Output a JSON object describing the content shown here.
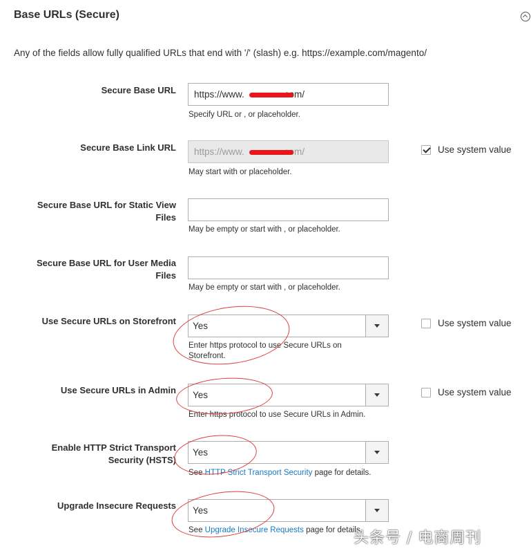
{
  "section": {
    "title": "Base URLs (Secure)",
    "intro": "Any of the fields allow fully qualified URLs that end with '/' (slash) e.g. https://example.com/magento/"
  },
  "fields": {
    "secure_base_url": {
      "label": "Secure Base URL",
      "value": "https://www.             com/",
      "value_prefix": "https://www.",
      "value_suffix": "com/",
      "note": "Specify URL or , or placeholder."
    },
    "secure_base_link_url": {
      "label": "Secure Base Link URL",
      "value_prefix": "https://www.",
      "value_suffix": "com/",
      "note": "May start with or placeholder.",
      "use_system_value": "Use system value",
      "use_system_checked": true
    },
    "static_view_files": {
      "label": "Secure Base URL for Static View Files",
      "value": "",
      "note": "May be empty or start with , or placeholder."
    },
    "user_media_files": {
      "label": "Secure Base URL for User Media Files",
      "value": "",
      "note": "May be empty or start with , or placeholder."
    },
    "secure_storefront": {
      "label": "Use Secure URLs on Storefront",
      "value": "Yes",
      "note": "Enter https protocol to use Secure URLs on Storefront.",
      "use_system_value": "Use system value",
      "use_system_checked": false
    },
    "secure_admin": {
      "label": "Use Secure URLs in Admin",
      "value": "Yes",
      "note": "Enter https protocol to use Secure URLs in Admin.",
      "use_system_value": "Use system value",
      "use_system_checked": false
    },
    "hsts": {
      "label": "Enable HTTP Strict Transport Security (HSTS)",
      "value": "Yes",
      "note_pre": "See ",
      "note_link": "HTTP Strict Transport Security",
      "note_post": " page for details."
    },
    "upgrade_insecure": {
      "label": "Upgrade Insecure Requests",
      "value": "Yes",
      "note_pre": "See ",
      "note_link": "Upgrade Insecure Requests",
      "note_post": " page for details."
    }
  },
  "colors": {
    "annotation": "#e03c3c",
    "redaction": "#e8151b",
    "link": "#1979c3"
  },
  "watermark": "头条号 / 电商周刊"
}
